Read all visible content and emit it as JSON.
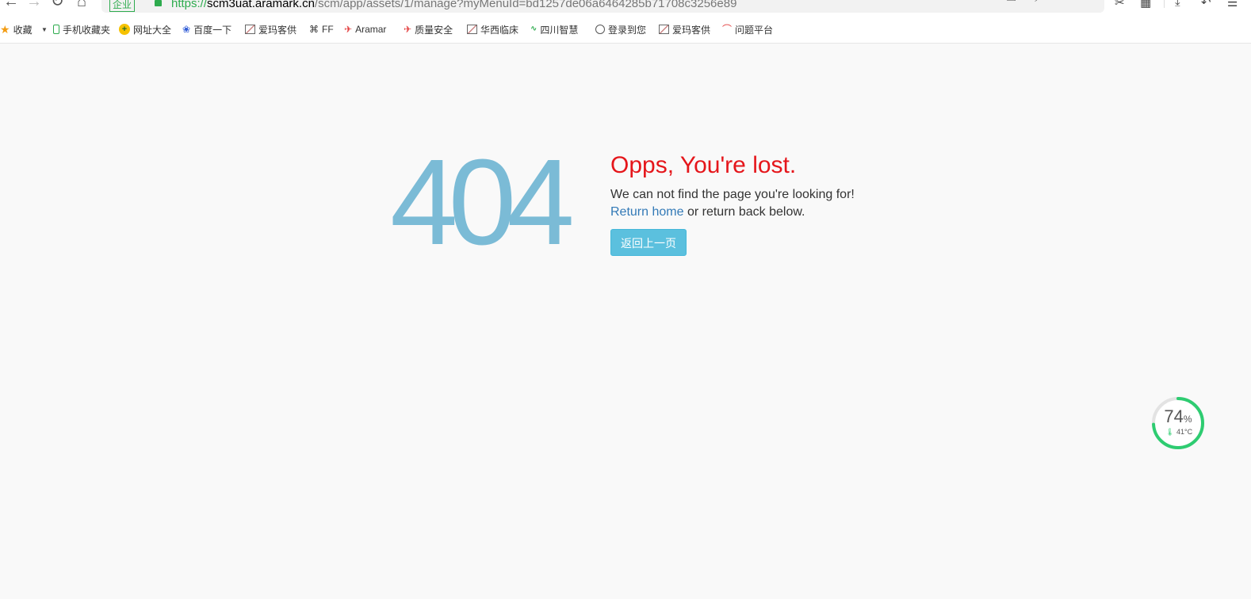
{
  "browser": {
    "nav": {
      "back": "←",
      "forward": "→",
      "reload": "↻",
      "home": "⌂"
    },
    "address": {
      "badge": "企业",
      "scheme": "https://",
      "host": "scm3uat.aramark.cn",
      "path": "/scm/app/assets/1/manage?myMenuId=bd1257de06a6464285b71708c3256e89"
    },
    "tools": [
      "⚿",
      "⚡",
      "···",
      "⌄",
      "✂",
      "▦",
      "⤓",
      "↶",
      "☰"
    ],
    "bookmarks": [
      {
        "label": "收藏",
        "icon": "star-icon"
      },
      {
        "label": "手机收藏夹",
        "icon": "phone-icon"
      },
      {
        "label": "网址大全",
        "icon": "directory-icon"
      },
      {
        "label": "百度一下",
        "icon": "baidu-icon"
      },
      {
        "label": "爱玛客供",
        "icon": "image-icon"
      },
      {
        "label": "FF",
        "icon": "grid-icon"
      },
      {
        "label": "Aramar",
        "icon": "aramark-icon"
      },
      {
        "label": "质量安全",
        "icon": "aramark-icon"
      },
      {
        "label": "华西临床",
        "icon": "image-icon"
      },
      {
        "label": "四川智慧",
        "icon": "chart-icon"
      },
      {
        "label": "登录到您",
        "icon": "globe-icon"
      },
      {
        "label": "爱玛客供",
        "icon": "image-icon"
      },
      {
        "label": "问题平台",
        "icon": "platform-icon"
      }
    ]
  },
  "page": {
    "code": "404",
    "headline": "Opps, You're lost.",
    "message": "We can not find the page you're looking for!",
    "return_link": "Return home",
    "return_suffix": " or return back below.",
    "back_button": "返回上一页"
  },
  "widget": {
    "percent": "74",
    "percent_sign": "%",
    "temperature": "41°C",
    "progress": 0.74,
    "color": "#2ecc71"
  }
}
